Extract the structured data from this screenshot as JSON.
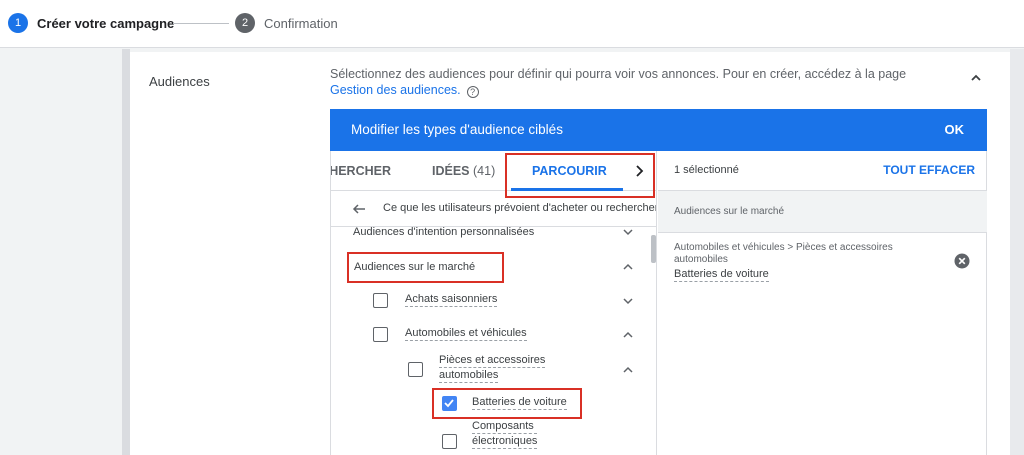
{
  "stepper": {
    "step1_number": "1",
    "step1_label": "Créer votre campagne",
    "step2_number": "2",
    "step2_label": "Confirmation"
  },
  "section": {
    "title": "Audiences",
    "description": "Sélectionnez des audiences pour définir qui pourra voir vos annonces.  Pour en créer, accédez à la page ",
    "description_link": "Gestion des audiences.",
    "help_glyph": "?"
  },
  "editor": {
    "header_title": "Modifier les types d'audience ciblés",
    "ok_label": "OK",
    "tabs": {
      "search": "RECHERCHER",
      "ideas": "IDÉES",
      "ideas_count": "(41)",
      "browse": "PARCOURIR"
    },
    "breadcrumb": "Ce que les utilisateurs prévoient d'acheter ou recherchent",
    "tree": {
      "custom_intent": "Audiences d'intention personnalisées",
      "in_market": "Audiences sur le marché",
      "seasonal": "Achats saisonniers",
      "autos": "Automobiles et véhicules",
      "parts_line1": "Pièces et accessoires",
      "parts_line2": "automobiles",
      "batteries": "Batteries de voiture",
      "electronics_line1": "Composants",
      "electronics_line2": "électroniques"
    },
    "selection": {
      "count_label": "1 sélectionné",
      "clear_label": "TOUT EFFACER",
      "group_label": "Audiences sur le marché",
      "item_path": "Automobiles et véhicules > Pièces et accessoires automobiles",
      "item_name": "Batteries de voiture"
    }
  },
  "icons": {
    "collapse": "chevron-up-icon",
    "tab_next": "chevron-right-icon",
    "back": "arrow-left-icon",
    "remove": "close-circle-icon"
  },
  "colors": {
    "accent": "#1a73e8",
    "highlight": "#d93025",
    "checkbox_checked": "#4285f4"
  }
}
